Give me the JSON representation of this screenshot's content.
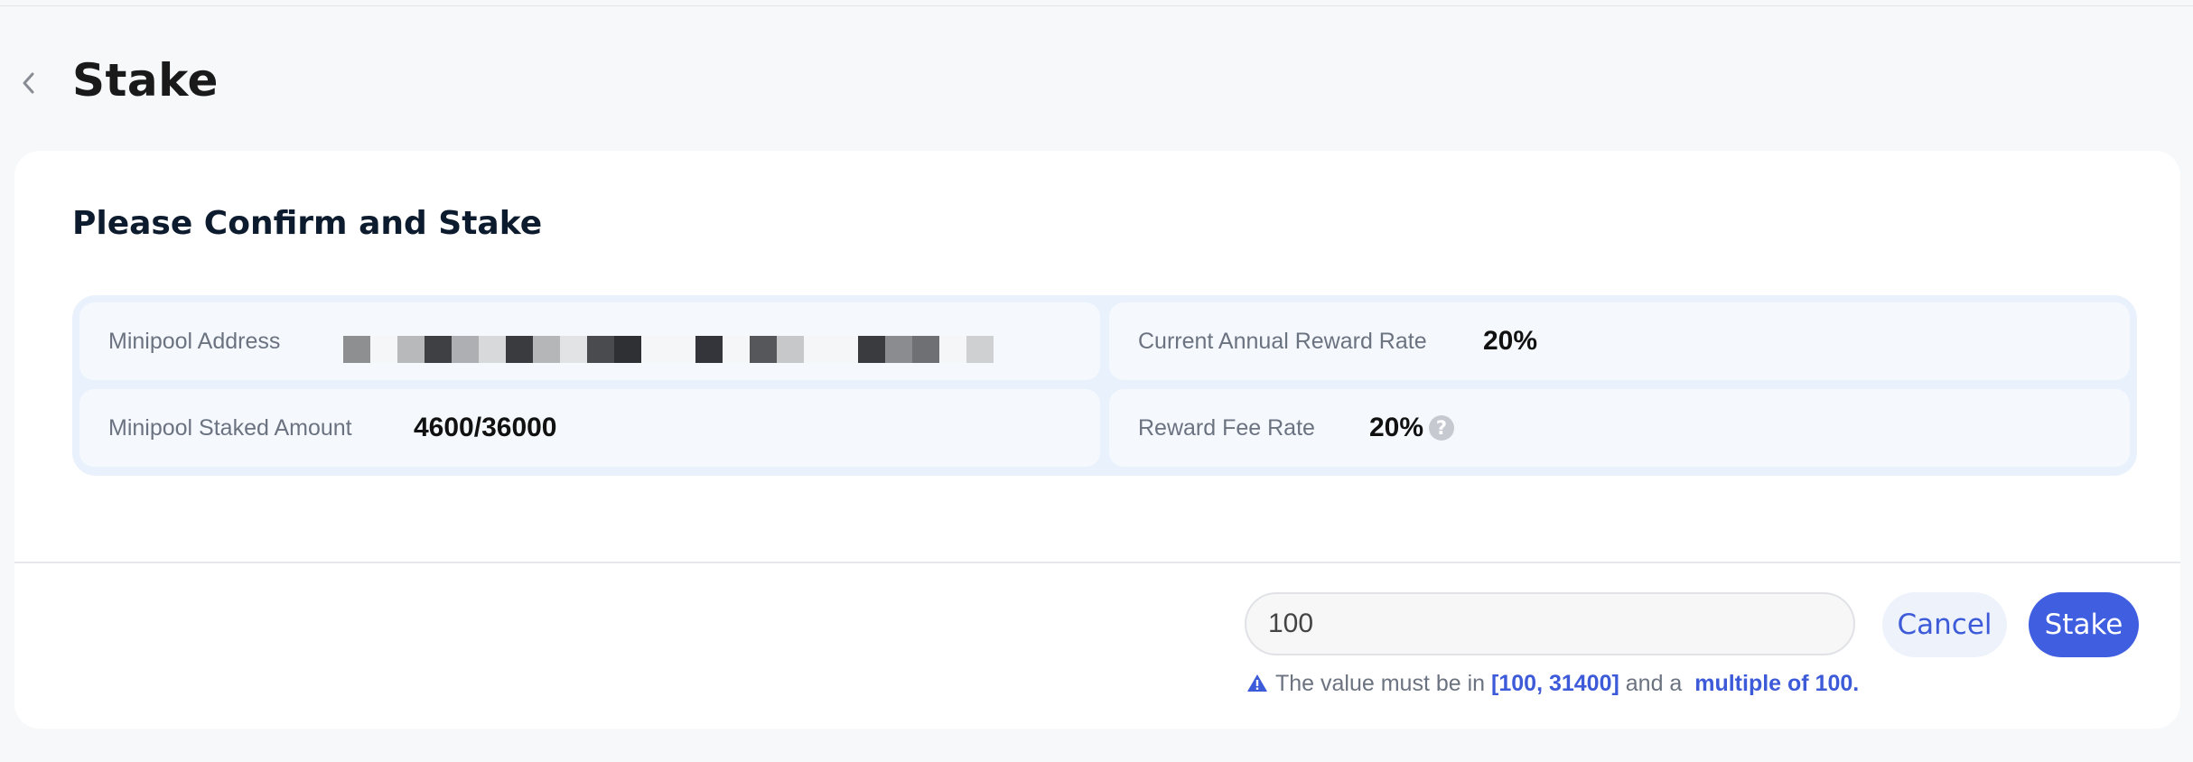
{
  "header": {
    "title": "Stake"
  },
  "card": {
    "title": "Please Confirm and Stake",
    "details": {
      "minipool_address_label": "Minipool Address",
      "minipool_staked_amount_label": "Minipool Staked Amount",
      "minipool_staked_amount_value": "4600/36000",
      "annual_reward_rate_label": "Current Annual Reward Rate",
      "annual_reward_rate_value": "20%",
      "reward_fee_rate_label": "Reward Fee Rate",
      "reward_fee_rate_value": "20%",
      "help_glyph": "?"
    }
  },
  "form": {
    "amount_value": "100",
    "cancel_label": "Cancel",
    "stake_label": "Stake",
    "hint": {
      "prefix": "The value must be in",
      "range": "[100, 31400]",
      "middle": "and a",
      "multiple": "multiple of 100."
    }
  },
  "colors": {
    "accent": "#3f5ee0",
    "background": "#f7f8fa",
    "card": "#ffffff",
    "info_panel": "#e8f1fc"
  },
  "icons": {
    "back": "chevron-left-icon",
    "help": "question-circle-icon",
    "warning": "warning-triangle-icon"
  }
}
